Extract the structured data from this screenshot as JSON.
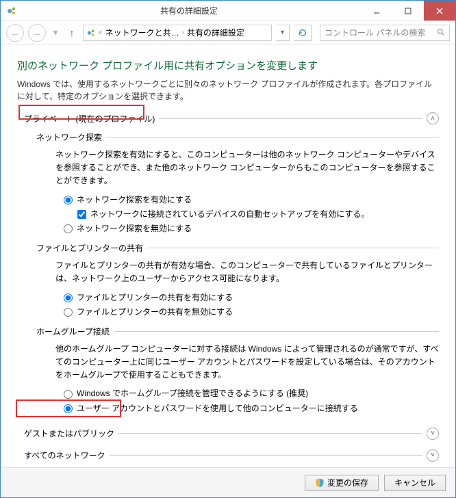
{
  "window": {
    "title": "共有の詳細設定"
  },
  "nav": {
    "breadcrumb_root": "ネットワークと共…",
    "breadcrumb_current": "共有の詳細設定",
    "search_placeholder": "コントロール パネルの検索"
  },
  "page": {
    "heading": "別のネットワーク プロファイル用に共有オプションを変更します",
    "description": "Windows では、使用するネットワークごとに別々のネットワーク プロファイルが作成されます。各プロファイルに対して、特定のオプションを選択できます。"
  },
  "sections": {
    "private": {
      "label": "プライベート (現在のプロファイル)",
      "network_discovery": {
        "title": "ネットワーク探索",
        "desc": "ネットワーク探索を有効にすると、このコンピューターは他のネットワーク コンピューターやデバイスを参照することができ、また他のネットワーク コンピューターからもこのコンピューターを参照することができます。",
        "opt_on": "ネットワーク探索を有効にする",
        "opt_auto": "ネットワークに接続されているデバイスの自動セットアップを有効にする。",
        "opt_off": "ネットワーク探索を無効にする"
      },
      "file_printer": {
        "title": "ファイルとプリンターの共有",
        "desc": "ファイルとプリンターの共有が有効な場合、このコンピューターで共有しているファイルとプリンターは、ネットワーク上のユーザーからアクセス可能になります。",
        "opt_on": "ファイルとプリンターの共有を有効にする",
        "opt_off": "ファイルとプリンターの共有を無効にする"
      },
      "homegroup": {
        "title": "ホームグループ接続",
        "desc": "他のホームグループ コンピューターに対する接続は Windows によって管理されるのが通常ですが、すべてのコンピューター上に同じユーザー アカウントとパスワードを設定している場合は、そのアカウントをホームグループで使用することもできます。",
        "opt_manage": "Windows でホームグループ接続を管理できるようにする (推奨)",
        "opt_user": "ユーザー アカウントとパスワードを使用して他のコンピューターに接続する"
      }
    },
    "guest": {
      "label": "ゲストまたはパブリック"
    },
    "all": {
      "label": "すべてのネットワーク"
    }
  },
  "buttons": {
    "save": "変更の保存",
    "cancel": "キャンセル"
  }
}
